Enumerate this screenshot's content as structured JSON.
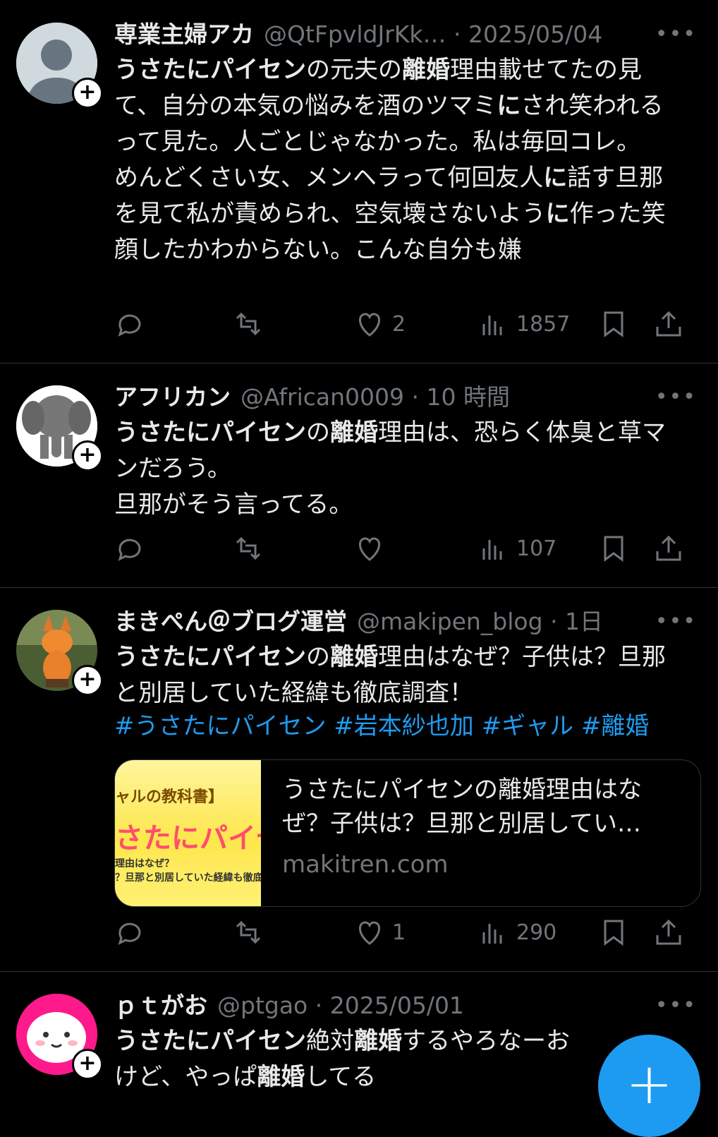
{
  "colors": {
    "background": "#000000",
    "text": "#e7e9ea",
    "muted": "#71767b",
    "accent": "#1d9bf0",
    "divider": "#2f3336"
  },
  "tweets": [
    {
      "name": "専業主婦アカ",
      "handle": "@QtFpvldJrKk…",
      "time": "· 2025/05/04",
      "body_parts": [
        {
          "t": "うさたにパイセン",
          "b": true
        },
        {
          "t": "の元夫の",
          "b": false
        },
        {
          "t": "離婚",
          "b": true
        },
        {
          "t": "理由載せてたの見て、自分の本気の悩みを酒のツマミ",
          "b": false
        },
        {
          "t": "に",
          "b": true
        },
        {
          "t": "され笑われるって見た。人ごとじゃなかった。私は毎回コレ。\nめんどくさい女、メンヘラって何回友人",
          "b": false
        },
        {
          "t": "に",
          "b": true
        },
        {
          "t": "話す旦那を見て私が責められ、空気壊さないよう",
          "b": false
        },
        {
          "t": "に",
          "b": true
        },
        {
          "t": "作った笑顔したかわからない。こんな自分も嫌",
          "b": false
        }
      ],
      "likes": "2",
      "views": "1857"
    },
    {
      "name": "アフリカン",
      "handle": "@African0009",
      "time": "· 10 時間",
      "body_parts": [
        {
          "t": "うさたにパイセン",
          "b": true
        },
        {
          "t": "の",
          "b": false
        },
        {
          "t": "離婚",
          "b": true
        },
        {
          "t": "理由は、恐らく体臭と草マンだろう。\n旦那がそう言ってる。",
          "b": false
        }
      ],
      "likes": "",
      "views": "107"
    },
    {
      "name": "まきぺん＠ブログ運営",
      "handle": "@makipen_blog",
      "time": "· 1日",
      "body_parts": [
        {
          "t": "うさたにパイセン",
          "b": true
        },
        {
          "t": "の",
          "b": false
        },
        {
          "t": "離婚",
          "b": true
        },
        {
          "t": "理由はなぜ？子供は？旦那と別居していた経緯も徹底調査！",
          "b": false
        }
      ],
      "hashtags": "#うさたにパイセン #岩本紗也加 #ギャル #離婚",
      "card": {
        "title": "うさたにパイセンの離婚理由はなぜ？子供は？旦那と別居してい…",
        "domain": "makitren.com",
        "thumb_line1": "ャルの教科書】",
        "thumb_line2": "さたにパイセ",
        "thumb_line3": "理由はなぜ？",
        "thumb_line4": "？旦那と別居していた経緯も徹底"
      },
      "likes": "1",
      "views": "290"
    },
    {
      "name": "ｐｔがお",
      "handle": "@ptgao",
      "time": "· 2025/05/01",
      "body_parts": [
        {
          "t": "うさたにパイセン",
          "b": true
        },
        {
          "t": "絶対",
          "b": false
        },
        {
          "t": "離婚",
          "b": true
        },
        {
          "t": "するやろなーお\nけど、やっぱ",
          "b": false
        },
        {
          "t": "離婚",
          "b": true
        },
        {
          "t": "してる",
          "b": false
        }
      ]
    }
  ],
  "icons": [
    "reply-icon",
    "retweet-icon",
    "like-icon",
    "views-icon",
    "bookmark-icon",
    "share-icon",
    "more-icon",
    "follow-plus-icon",
    "compose-icon"
  ],
  "fab_label": "+",
  "more_label": "•••",
  "plus_label": "+"
}
